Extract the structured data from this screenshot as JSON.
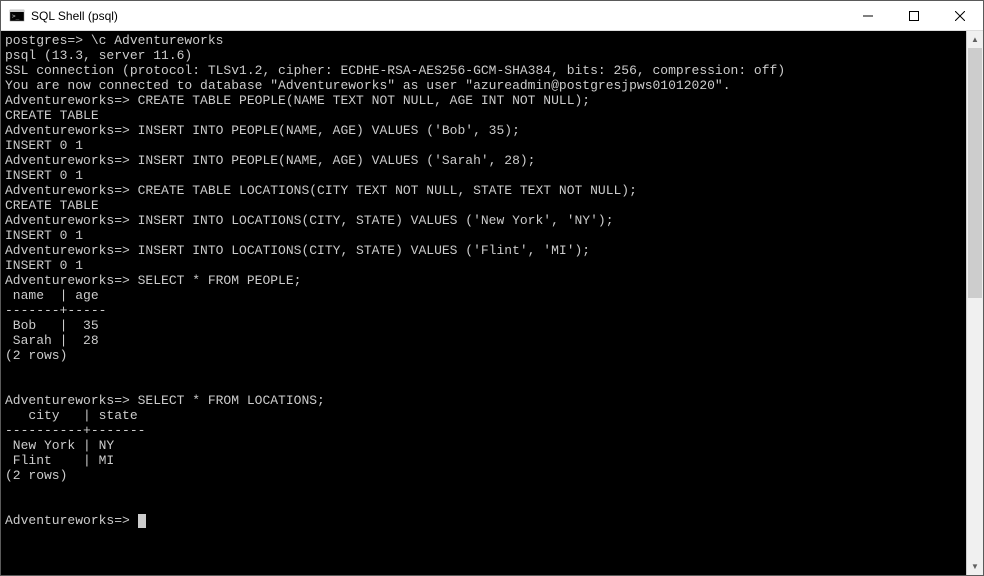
{
  "window": {
    "title": "SQL Shell (psql)"
  },
  "terminal": {
    "lines": [
      "postgres=> \\c Adventureworks",
      "psql (13.3, server 11.6)",
      "SSL connection (protocol: TLSv1.2, cipher: ECDHE-RSA-AES256-GCM-SHA384, bits: 256, compression: off)",
      "You are now connected to database \"Adventureworks\" as user \"azureadmin@postgresjpws01012020\".",
      "Adventureworks=> CREATE TABLE PEOPLE(NAME TEXT NOT NULL, AGE INT NOT NULL);",
      "CREATE TABLE",
      "Adventureworks=> INSERT INTO PEOPLE(NAME, AGE) VALUES ('Bob', 35);",
      "INSERT 0 1",
      "Adventureworks=> INSERT INTO PEOPLE(NAME, AGE) VALUES ('Sarah', 28);",
      "INSERT 0 1",
      "Adventureworks=> CREATE TABLE LOCATIONS(CITY TEXT NOT NULL, STATE TEXT NOT NULL);",
      "CREATE TABLE",
      "Adventureworks=> INSERT INTO LOCATIONS(CITY, STATE) VALUES ('New York', 'NY');",
      "INSERT 0 1",
      "Adventureworks=> INSERT INTO LOCATIONS(CITY, STATE) VALUES ('Flint', 'MI');",
      "INSERT 0 1",
      "Adventureworks=> SELECT * FROM PEOPLE;",
      " name  | age",
      "-------+-----",
      " Bob   |  35",
      " Sarah |  28",
      "(2 rows)",
      "",
      "",
      "Adventureworks=> SELECT * FROM LOCATIONS;",
      "   city   | state",
      "----------+-------",
      " New York | NY",
      " Flint    | MI",
      "(2 rows)",
      "",
      "",
      "Adventureworks=>"
    ],
    "prompt_cursor": true
  }
}
